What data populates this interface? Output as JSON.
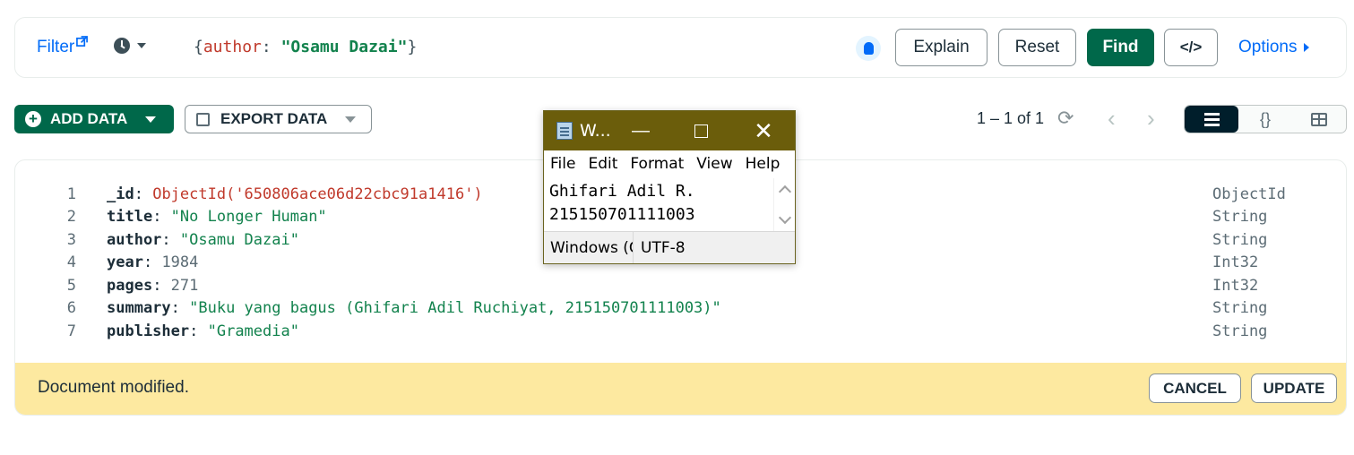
{
  "filter_bar": {
    "filter_label": "Filter",
    "query_open": "{",
    "query_key": "author",
    "query_colon": ": ",
    "query_value": "\"Osamu Dazai\"",
    "query_close": "}",
    "explain_label": "Explain",
    "reset_label": "Reset",
    "find_label": "Find",
    "code_label": "</>",
    "options_label": "Options"
  },
  "toolbar": {
    "add_data_label": "ADD DATA",
    "export_data_label": "EXPORT DATA",
    "pagination": "1 – 1 of 1",
    "refresh_glyph": "⟳",
    "prev_glyph": "‹",
    "next_glyph": "›",
    "json_view_glyph": "{}"
  },
  "document": {
    "lines": [
      {
        "num": "1",
        "key": "_id",
        "value": "ObjectId('650806ace06d22cbc91a1416')",
        "kind": "oid",
        "type": "ObjectId"
      },
      {
        "num": "2",
        "key": "title",
        "value": "\"No Longer Human\"",
        "kind": "str",
        "type": "String"
      },
      {
        "num": "3",
        "key": "author",
        "value": "\"Osamu Dazai\"",
        "kind": "str",
        "type": "String"
      },
      {
        "num": "4",
        "key": "year",
        "value": "1984",
        "kind": "num",
        "type": "Int32"
      },
      {
        "num": "5",
        "key": "pages",
        "value": "271",
        "kind": "num",
        "type": "Int32"
      },
      {
        "num": "6",
        "key": "summary",
        "value": "\"Buku yang bagus (Ghifari Adil Ruchiyat, 215150701111003)\"",
        "kind": "str",
        "type": "String"
      },
      {
        "num": "7",
        "key": "publisher",
        "value": "\"Gramedia\"",
        "kind": "str",
        "type": "String"
      }
    ],
    "modified_text": "Document modified.",
    "cancel_label": "CANCEL",
    "update_label": "UPDATE"
  },
  "notepad": {
    "title": "W...",
    "minimize_glyph": "—",
    "close_glyph": "✕",
    "menu": [
      "File",
      "Edit",
      "Format",
      "View",
      "Help"
    ],
    "text_line1": "Ghifari Adil R.",
    "text_line2": "215150701111003",
    "status_line_ending": "Windows (C",
    "status_encoding": "UTF-8"
  },
  "colors": {
    "accent_green": "#00684a",
    "link_blue": "#016bf8",
    "modified_bg": "#fde9a0",
    "notepad_title": "#6b5d0b"
  },
  "icons": [
    "external-link-icon",
    "clock-icon",
    "lightbulb-icon",
    "plus-circle-icon",
    "export-icon",
    "refresh-icon",
    "list-view-icon",
    "json-view-icon",
    "table-view-icon",
    "notepad-icon"
  ]
}
